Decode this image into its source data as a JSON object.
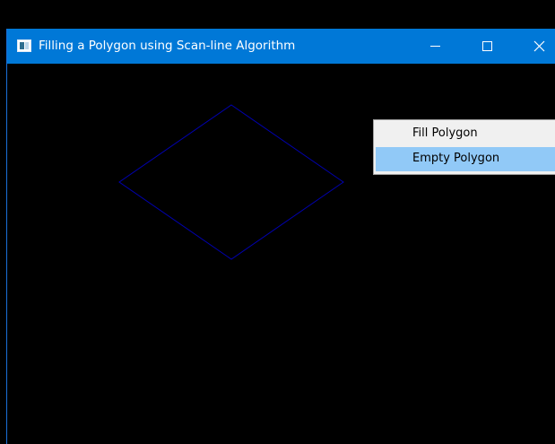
{
  "window": {
    "title": "Filling a Polygon using Scan-line Algorithm",
    "controls": {
      "minimize": "minimize",
      "maximize": "maximize",
      "close": "close"
    }
  },
  "canvas": {
    "background": "#000000",
    "polygon": {
      "stroke_color": "#0000b0",
      "filled": false
    }
  },
  "context_menu": {
    "items": [
      {
        "label": "Fill Polygon",
        "highlighted": false
      },
      {
        "label": "Empty Polygon",
        "highlighted": true
      }
    ],
    "highlight_color": "#91c9f7"
  },
  "colors": {
    "titlebar": "#0078d7",
    "title_text": "#ffffff"
  }
}
